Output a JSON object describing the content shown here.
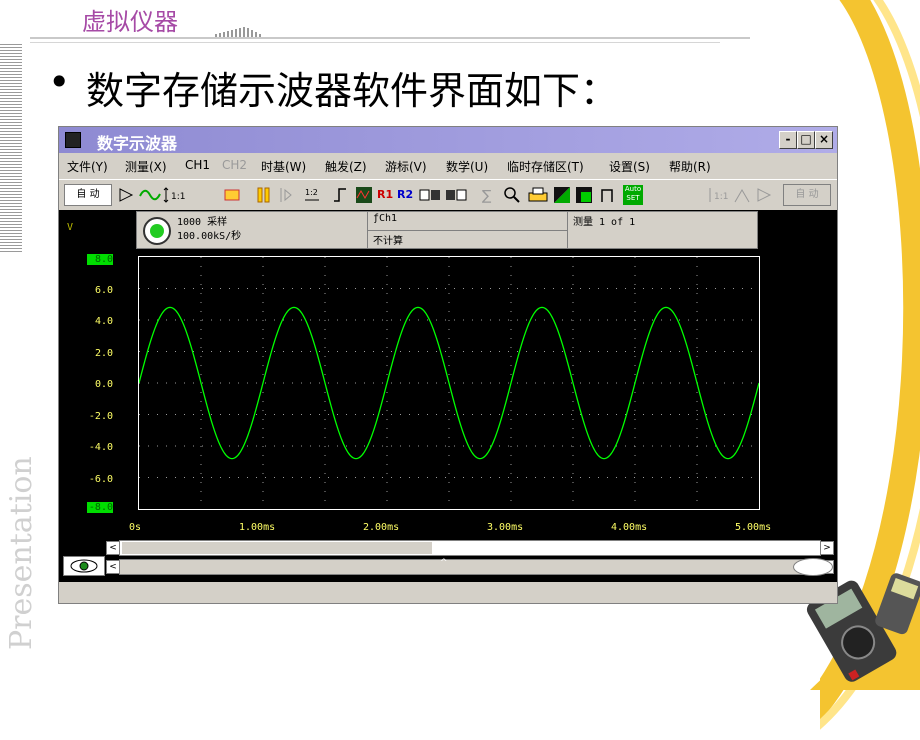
{
  "slide": {
    "header": "虚拟仪器",
    "bullet": "•",
    "heading": "数字存储示波器软件界面如下：",
    "side_text": "Presentation"
  },
  "window": {
    "title": "数字示波器",
    "minimize": "-",
    "maximize": "□",
    "close": "×"
  },
  "menu": [
    "文件(Y)",
    "测量(X)",
    "CH1",
    "CH2",
    "时基(W)",
    "触发(Z)",
    "游标(V)",
    "数学(U)",
    "临时存储区(T)",
    "设置(S)",
    "帮助(R)"
  ],
  "toolbar": {
    "auto_label": "自 动",
    "auto_label_right": "自 动",
    "r1": "R1",
    "r2": "R2",
    "autoset": "Auto SET"
  },
  "info": {
    "samples": "1000 采样",
    "rate": "100.00kS/秒",
    "channel": "ƒCh1",
    "calc": "不计算",
    "measure": "测量 1 of 1"
  },
  "scope": {
    "y_unit": "V",
    "y_ticks": [
      "8.0",
      "6.0",
      "4.0",
      "2.0",
      "0.0",
      "-2.0",
      "-4.0",
      "-6.0",
      "-8.0"
    ],
    "x_ticks": [
      "0s",
      "1.00ms",
      "2.00ms",
      "3.00ms",
      "4.00ms",
      "5.00ms"
    ],
    "trace_color": "#00ff00",
    "background": "#000000",
    "grid_color": "#9a9a9a"
  },
  "chart_data": {
    "type": "line",
    "xlabel": "",
    "ylabel": "V",
    "xlim": [
      0,
      5
    ],
    "ylim": [
      -8,
      8
    ],
    "series": [
      {
        "frequency_khz": 1.0,
        "amplitude": 4.8,
        "offset": 0.0,
        "phase_start": "rising"
      }
    ]
  },
  "scrollbars": {
    "left_arrow": "<",
    "right_arrow": ">",
    "center_mark": "^"
  }
}
